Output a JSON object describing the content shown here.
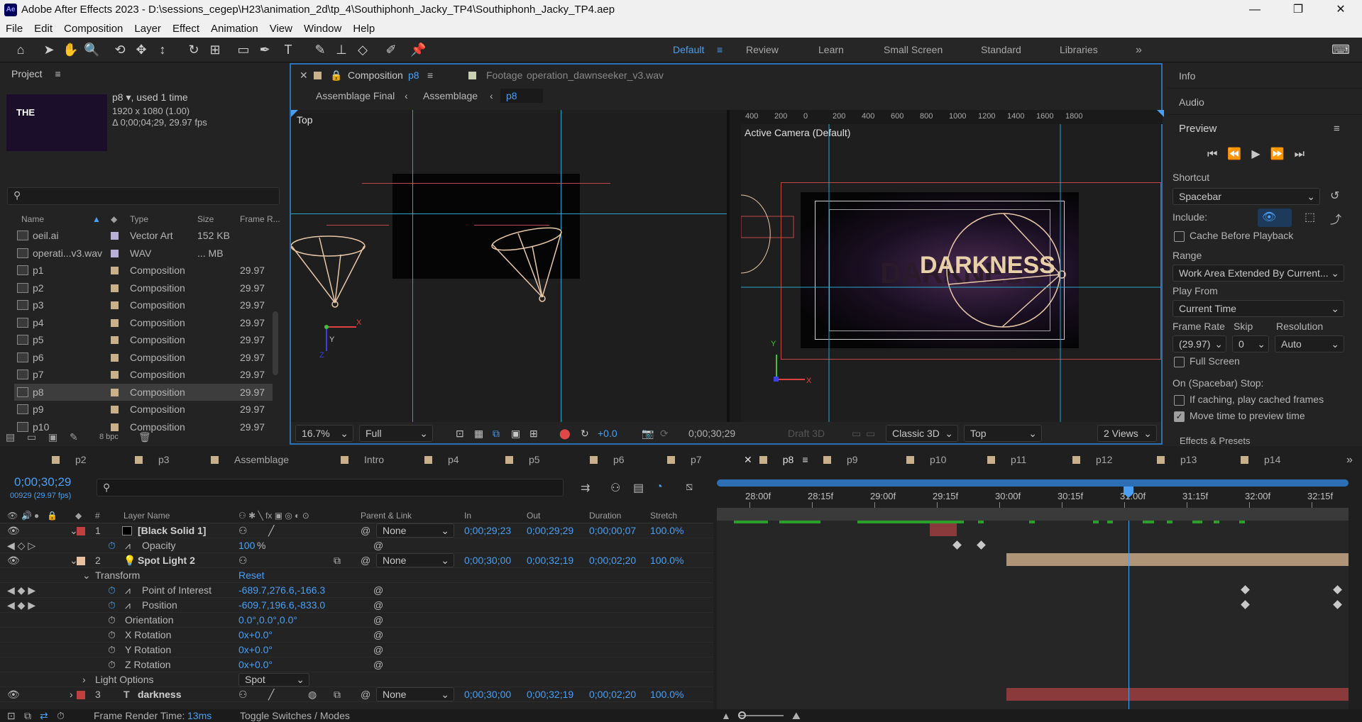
{
  "app": {
    "title": "Adobe After Effects 2023 - D:\\sessions_cegep\\H23\\animation_2d\\tp_4\\Southiphonh_Jacky_TP4\\Southiphonh_Jacky_TP4.aep",
    "logo": "Ae"
  },
  "menu": [
    "File",
    "Edit",
    "Composition",
    "Layer",
    "Effect",
    "Animation",
    "View",
    "Window",
    "Help"
  ],
  "workspaces": [
    "Default",
    "Review",
    "Learn",
    "Small Screen",
    "Standard",
    "Libraries"
  ],
  "project": {
    "panel_title": "Project",
    "thumb_text": "THE",
    "item_name": "p8",
    "used": ", used 1 time",
    "dims": "1920 x 1080 (1.00)",
    "duration": "Δ 0;00;04;29, 29.97 fps",
    "columns": {
      "name": "Name",
      "type": "Type",
      "size": "Size",
      "frame_rate": "Frame R..."
    },
    "items": [
      {
        "name": "oeil.ai",
        "type": "Vector Art",
        "size": "152 KB",
        "fr": ""
      },
      {
        "name": "operati...v3.wav",
        "type": "WAV",
        "size": "... MB",
        "fr": ""
      },
      {
        "name": "p1",
        "type": "Composition",
        "size": "",
        "fr": "29.97"
      },
      {
        "name": "p2",
        "type": "Composition",
        "size": "",
        "fr": "29.97"
      },
      {
        "name": "p3",
        "type": "Composition",
        "size": "",
        "fr": "29.97"
      },
      {
        "name": "p4",
        "type": "Composition",
        "size": "",
        "fr": "29.97"
      },
      {
        "name": "p5",
        "type": "Composition",
        "size": "",
        "fr": "29.97"
      },
      {
        "name": "p6",
        "type": "Composition",
        "size": "",
        "fr": "29.97"
      },
      {
        "name": "p7",
        "type": "Composition",
        "size": "",
        "fr": "29.97"
      },
      {
        "name": "p8",
        "type": "Composition",
        "size": "",
        "fr": "29.97"
      },
      {
        "name": "p9",
        "type": "Composition",
        "size": "",
        "fr": "29.97"
      },
      {
        "name": "p10",
        "type": "Composition",
        "size": "",
        "fr": "29.97"
      }
    ],
    "bpc": "8 bpc"
  },
  "comp_viewer": {
    "tab_comp": "Composition",
    "tab_comp_name": "p8",
    "tab_footage": "Footage",
    "tab_footage_name": "operation_dawnseeker_v3.wav",
    "breadcrumbs": [
      "Assemblage Final",
      "Assemblage",
      "p8"
    ],
    "left_view_label": "Top",
    "right_view_label": "Active Camera (Default)",
    "text_front": "DARKNESS",
    "text_back": "DARKNESS",
    "ruler": [
      "400",
      "200",
      "0",
      "200",
      "400",
      "600",
      "800",
      "1000",
      "1200",
      "1400",
      "1600",
      "1800"
    ],
    "axis": {
      "x": "X",
      "y": "Y",
      "z": "Z"
    },
    "zoom": "16.7%",
    "resolution": "Full",
    "exposure": "+0.0",
    "timecode": "0;00;30;29",
    "draft": "Draft 3D",
    "renderer": "Classic 3D",
    "view": "Top",
    "layout": "2 Views"
  },
  "right_panel": {
    "info": "Info",
    "audio": "Audio",
    "preview": "Preview",
    "shortcut_label": "Shortcut",
    "shortcut": "Spacebar",
    "include_label": "Include:",
    "cache_before": "Cache Before Playback",
    "range_label": "Range",
    "range": "Work Area Extended By Current...",
    "play_from_label": "Play From",
    "play_from": "Current Time",
    "frame_rate_label": "Frame Rate",
    "skip_label": "Skip",
    "resolution_label": "Resolution",
    "frame_rate": "(29.97)",
    "skip": "0",
    "resolution": "Auto",
    "full_screen": "Full Screen",
    "stop_label": "On (Spacebar) Stop:",
    "if_caching": "If caching, play cached frames",
    "move_time": "Move time to preview time",
    "effects": "Effects & Presets"
  },
  "timeline": {
    "tabs": [
      "p2",
      "p3",
      "Assemblage",
      "Intro",
      "p4",
      "p5",
      "p6",
      "p7",
      "p8",
      "p9",
      "p10",
      "p11",
      "p12",
      "p13",
      "p14"
    ],
    "tab_colors": [
      "#c8b08a",
      "#c8b08a",
      "#c8b08a",
      "#c8b08a",
      "#c8b08a",
      "#c8b08a",
      "#c8b08a",
      "#c8b08a",
      "#c8b08a",
      "#c8b08a",
      "#c8b08a",
      "#c8b08a",
      "#c8b08a",
      "#c8b08a",
      "#c8b08a"
    ],
    "current_time": "0;00;30;29",
    "frame_info": "00929 (29.97 fps)",
    "col_headers": {
      "layer_name": "Layer Name",
      "parent": "Parent & Link",
      "in": "In",
      "out": "Out",
      "duration": "Duration",
      "stretch": "Stretch"
    },
    "ruler": [
      "28:00f",
      "28:15f",
      "29:00f",
      "29:15f",
      "30:00f",
      "30:15f",
      "31:00f",
      "31:15f",
      "32:00f",
      "32:15f"
    ],
    "layers": [
      {
        "num": "1",
        "name": "[Black Solid 1]",
        "parent": "None",
        "in": "0;00;29;23",
        "out": "0;00;29;29",
        "dur": "0;00;00;07",
        "stretch": "100.0%",
        "color": "#c04040"
      },
      {
        "num": "2",
        "name": "Spot Light 2",
        "parent": "None",
        "in": "0;00;30;00",
        "out": "0;00;32;19",
        "dur": "0;00;02;20",
        "stretch": "100.0%",
        "color": "#e8c0a0"
      },
      {
        "num": "3",
        "name": "darkness",
        "parent": "None",
        "in": "0;00;30;00",
        "out": "0;00;32;19",
        "dur": "0;00;02;20",
        "stretch": "100.0%",
        "color": "#c04040"
      }
    ],
    "props": {
      "opacity": {
        "label": "Opacity",
        "value": "100",
        "unit": "%"
      },
      "transform": "Transform",
      "reset": "Reset",
      "poi": {
        "label": "Point of Interest",
        "value": "-689.7,276.6,-166.3"
      },
      "position": {
        "label": "Position",
        "value": "-609.7,196.6,-833.0"
      },
      "orientation": {
        "label": "Orientation",
        "value": "0.0°,0.0°,0.0°"
      },
      "xrot": {
        "label": "X Rotation",
        "value": "0x+0.0°"
      },
      "yrot": {
        "label": "Y Rotation",
        "value": "0x+0.0°"
      },
      "zrot": {
        "label": "Z Rotation",
        "value": "0x+0.0°"
      },
      "light_options": "Light Options",
      "light_type": "Spot"
    },
    "footer": {
      "render_label": "Frame Render Time:",
      "render_value": "13ms",
      "toggle": "Toggle Switches / Modes"
    }
  }
}
